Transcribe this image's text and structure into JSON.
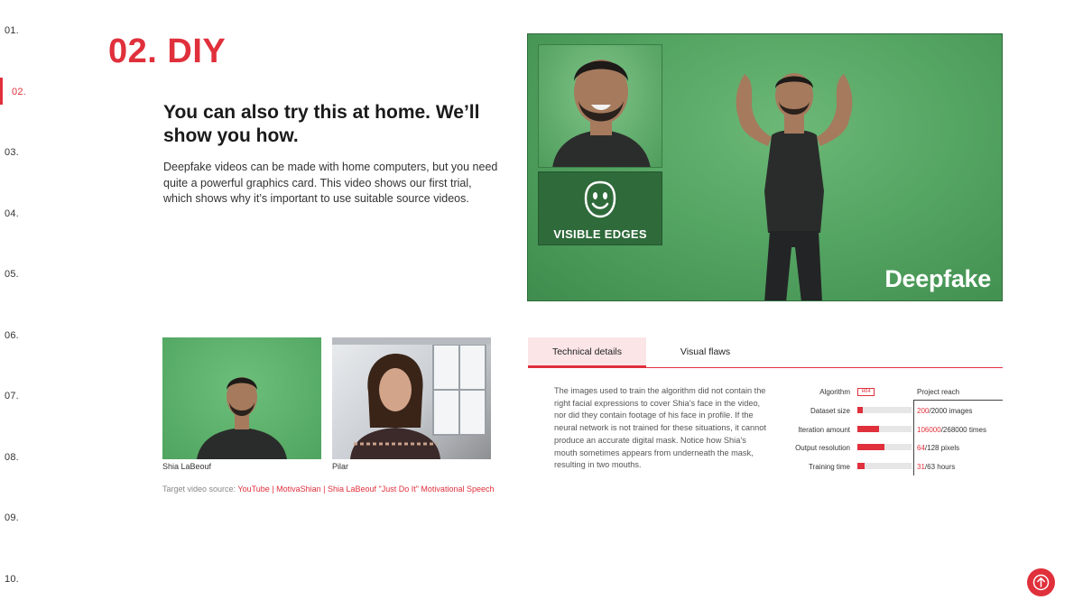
{
  "nav": {
    "items": [
      "01.",
      "02.",
      "03.",
      "04.",
      "05.",
      "06.",
      "07.",
      "08.",
      "09.",
      "10."
    ],
    "active_index": 1
  },
  "section": {
    "title": "02. DIY",
    "subheading": "You can also try this at home. We’ll show you how.",
    "intro": "Deepfake videos can be made with home computers, but you need quite a powerful graphics card. This video shows our first trial, which shows why it’s important to use suitable source videos."
  },
  "video": {
    "edge_label": "VISIBLE EDGES",
    "brand": "Deepfake"
  },
  "thumbnails": [
    {
      "caption": "Shia LaBeouf"
    },
    {
      "caption": "Pilar"
    }
  ],
  "source": {
    "prefix": "Target video source: ",
    "links": [
      "YouTube",
      "MotivaShian",
      "Shia LaBeouf \"Just Do It\" Motivational Speech"
    ],
    "separator": " | "
  },
  "tabs": [
    "Technical details",
    "Visual flaws"
  ],
  "technical_details": {
    "text": "The images used to train the algorithm did not contain the right facial expressions to cover Shia’s face in the video, nor did they contain footage of his face in profile. If the neural network is not trained for these situations, it cannot produce an accurate digital mask. Notice how Shia’s mouth sometimes appears from underneath the mask, resulting in two mouths."
  },
  "metrics": {
    "algorithm_label": "Algorithm",
    "algorithm_value": "H64",
    "reach_title": "Project reach",
    "rows": [
      {
        "label": "Dataset size",
        "value": "200",
        "total": "/2000 images",
        "fraction": 0.1
      },
      {
        "label": "Iteration amount",
        "value": "106000",
        "total": "/268000 times",
        "fraction": 0.3955
      },
      {
        "label": "Output resolution",
        "value": "64",
        "total": "/128 pixels",
        "fraction": 0.5
      },
      {
        "label": "Training time",
        "value": "31",
        "total": "/63 hours",
        "fraction": 0.13
      }
    ]
  },
  "colors": {
    "accent": "#e0303c",
    "green_screen": "#55a563"
  },
  "icons": [
    "face-mask-icon",
    "arrow-up-icon"
  ]
}
